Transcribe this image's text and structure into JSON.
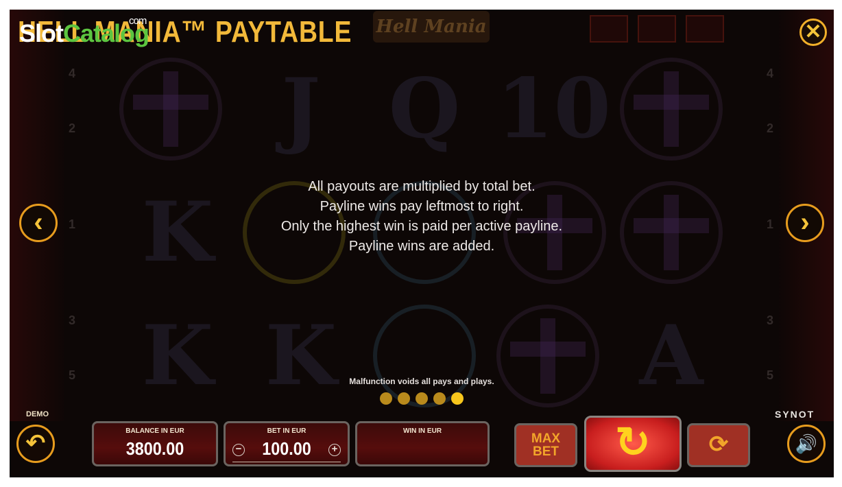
{
  "watermark": {
    "part1": "Slot",
    "part2": "Catalog",
    "suffix": "com"
  },
  "header": {
    "title": "HELL MANIA™ PAYTABLE",
    "game_logo": "Hell Mania",
    "close_icon": "✕"
  },
  "nav": {
    "prev_icon": "‹",
    "next_icon": "›"
  },
  "reel_numbers": {
    "left": [
      "4",
      "2",
      "1",
      "3",
      "5"
    ],
    "right": [
      "4",
      "2",
      "1",
      "3",
      "5"
    ]
  },
  "background_letters": [
    "J",
    "Q",
    "10",
    "K",
    "K",
    "K",
    "A"
  ],
  "info": {
    "lines": [
      "All payouts are multiplied by total bet.",
      "Payline wins pay leftmost to right.",
      "Only the highest win is paid per active payline.",
      "Payline wins are added."
    ],
    "disclaimer": "Malfunction voids all pays and plays."
  },
  "pagination": {
    "total": 5,
    "active_index": 4
  },
  "bottom": {
    "demo_label": "DEMO",
    "back_icon": "↶",
    "balance_label": "BALANCE IN EUR",
    "balance_value": "3800.00",
    "bet_label": "BET IN EUR",
    "bet_value": "100.00",
    "bet_minus": "−",
    "bet_plus": "+",
    "win_label": "WIN IN EUR",
    "win_value": "",
    "maxbet_line1": "MAX",
    "maxbet_line2": "BET",
    "spin_icon": "↻",
    "autoplay_icon": "⟳",
    "brand": "SYNOT",
    "sound_icon": "🔊"
  },
  "colors": {
    "accent": "#f2b93a",
    "button_red": "#a03024",
    "watermark_green": "#5cc540"
  }
}
